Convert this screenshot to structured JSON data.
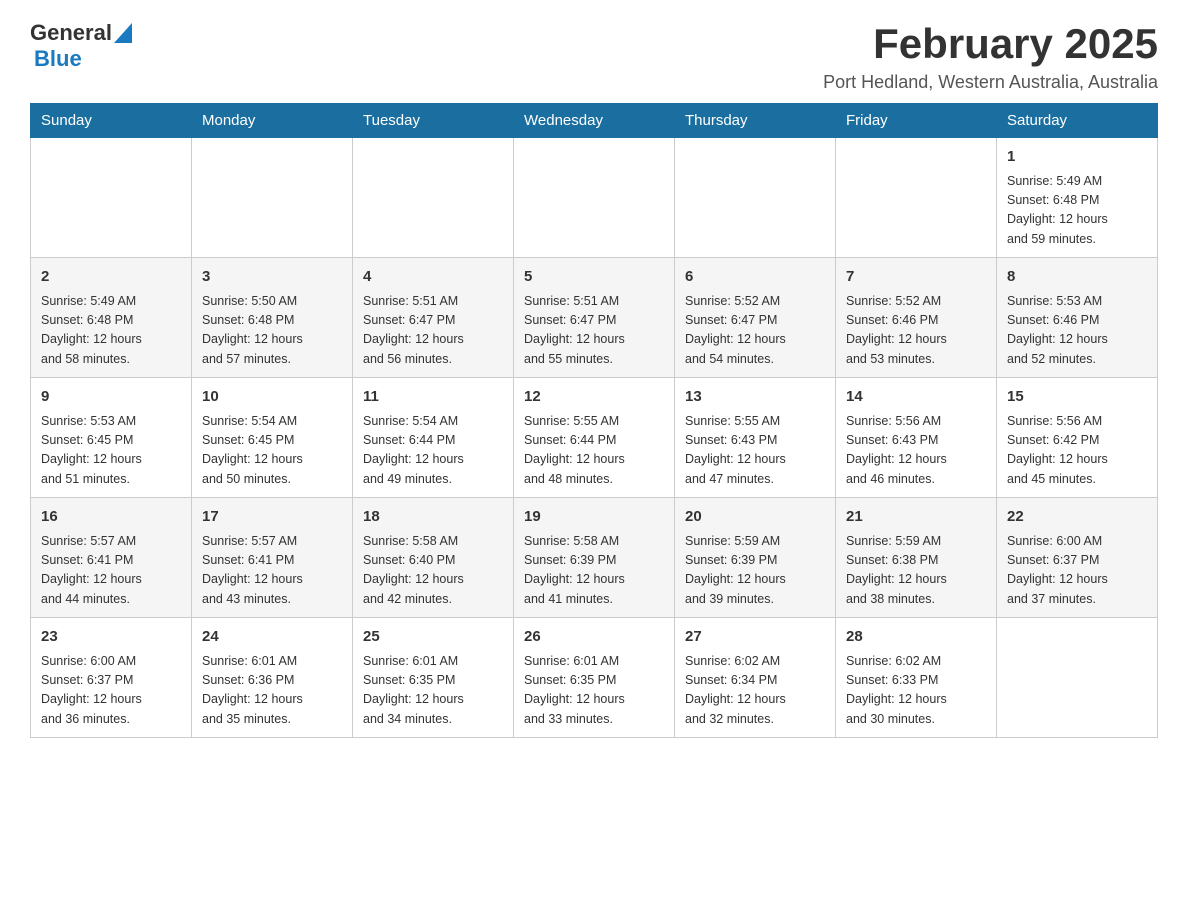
{
  "header": {
    "logo": {
      "general": "General",
      "blue": "Blue"
    },
    "title": "February 2025",
    "location": "Port Hedland, Western Australia, Australia"
  },
  "weekdays": [
    "Sunday",
    "Monday",
    "Tuesday",
    "Wednesday",
    "Thursday",
    "Friday",
    "Saturday"
  ],
  "weeks": [
    [
      {
        "day": "",
        "info": ""
      },
      {
        "day": "",
        "info": ""
      },
      {
        "day": "",
        "info": ""
      },
      {
        "day": "",
        "info": ""
      },
      {
        "day": "",
        "info": ""
      },
      {
        "day": "",
        "info": ""
      },
      {
        "day": "1",
        "info": "Sunrise: 5:49 AM\nSunset: 6:48 PM\nDaylight: 12 hours\nand 59 minutes."
      }
    ],
    [
      {
        "day": "2",
        "info": "Sunrise: 5:49 AM\nSunset: 6:48 PM\nDaylight: 12 hours\nand 58 minutes."
      },
      {
        "day": "3",
        "info": "Sunrise: 5:50 AM\nSunset: 6:48 PM\nDaylight: 12 hours\nand 57 minutes."
      },
      {
        "day": "4",
        "info": "Sunrise: 5:51 AM\nSunset: 6:47 PM\nDaylight: 12 hours\nand 56 minutes."
      },
      {
        "day": "5",
        "info": "Sunrise: 5:51 AM\nSunset: 6:47 PM\nDaylight: 12 hours\nand 55 minutes."
      },
      {
        "day": "6",
        "info": "Sunrise: 5:52 AM\nSunset: 6:47 PM\nDaylight: 12 hours\nand 54 minutes."
      },
      {
        "day": "7",
        "info": "Sunrise: 5:52 AM\nSunset: 6:46 PM\nDaylight: 12 hours\nand 53 minutes."
      },
      {
        "day": "8",
        "info": "Sunrise: 5:53 AM\nSunset: 6:46 PM\nDaylight: 12 hours\nand 52 minutes."
      }
    ],
    [
      {
        "day": "9",
        "info": "Sunrise: 5:53 AM\nSunset: 6:45 PM\nDaylight: 12 hours\nand 51 minutes."
      },
      {
        "day": "10",
        "info": "Sunrise: 5:54 AM\nSunset: 6:45 PM\nDaylight: 12 hours\nand 50 minutes."
      },
      {
        "day": "11",
        "info": "Sunrise: 5:54 AM\nSunset: 6:44 PM\nDaylight: 12 hours\nand 49 minutes."
      },
      {
        "day": "12",
        "info": "Sunrise: 5:55 AM\nSunset: 6:44 PM\nDaylight: 12 hours\nand 48 minutes."
      },
      {
        "day": "13",
        "info": "Sunrise: 5:55 AM\nSunset: 6:43 PM\nDaylight: 12 hours\nand 47 minutes."
      },
      {
        "day": "14",
        "info": "Sunrise: 5:56 AM\nSunset: 6:43 PM\nDaylight: 12 hours\nand 46 minutes."
      },
      {
        "day": "15",
        "info": "Sunrise: 5:56 AM\nSunset: 6:42 PM\nDaylight: 12 hours\nand 45 minutes."
      }
    ],
    [
      {
        "day": "16",
        "info": "Sunrise: 5:57 AM\nSunset: 6:41 PM\nDaylight: 12 hours\nand 44 minutes."
      },
      {
        "day": "17",
        "info": "Sunrise: 5:57 AM\nSunset: 6:41 PM\nDaylight: 12 hours\nand 43 minutes."
      },
      {
        "day": "18",
        "info": "Sunrise: 5:58 AM\nSunset: 6:40 PM\nDaylight: 12 hours\nand 42 minutes."
      },
      {
        "day": "19",
        "info": "Sunrise: 5:58 AM\nSunset: 6:39 PM\nDaylight: 12 hours\nand 41 minutes."
      },
      {
        "day": "20",
        "info": "Sunrise: 5:59 AM\nSunset: 6:39 PM\nDaylight: 12 hours\nand 39 minutes."
      },
      {
        "day": "21",
        "info": "Sunrise: 5:59 AM\nSunset: 6:38 PM\nDaylight: 12 hours\nand 38 minutes."
      },
      {
        "day": "22",
        "info": "Sunrise: 6:00 AM\nSunset: 6:37 PM\nDaylight: 12 hours\nand 37 minutes."
      }
    ],
    [
      {
        "day": "23",
        "info": "Sunrise: 6:00 AM\nSunset: 6:37 PM\nDaylight: 12 hours\nand 36 minutes."
      },
      {
        "day": "24",
        "info": "Sunrise: 6:01 AM\nSunset: 6:36 PM\nDaylight: 12 hours\nand 35 minutes."
      },
      {
        "day": "25",
        "info": "Sunrise: 6:01 AM\nSunset: 6:35 PM\nDaylight: 12 hours\nand 34 minutes."
      },
      {
        "day": "26",
        "info": "Sunrise: 6:01 AM\nSunset: 6:35 PM\nDaylight: 12 hours\nand 33 minutes."
      },
      {
        "day": "27",
        "info": "Sunrise: 6:02 AM\nSunset: 6:34 PM\nDaylight: 12 hours\nand 32 minutes."
      },
      {
        "day": "28",
        "info": "Sunrise: 6:02 AM\nSunset: 6:33 PM\nDaylight: 12 hours\nand 30 minutes."
      },
      {
        "day": "",
        "info": ""
      }
    ]
  ]
}
